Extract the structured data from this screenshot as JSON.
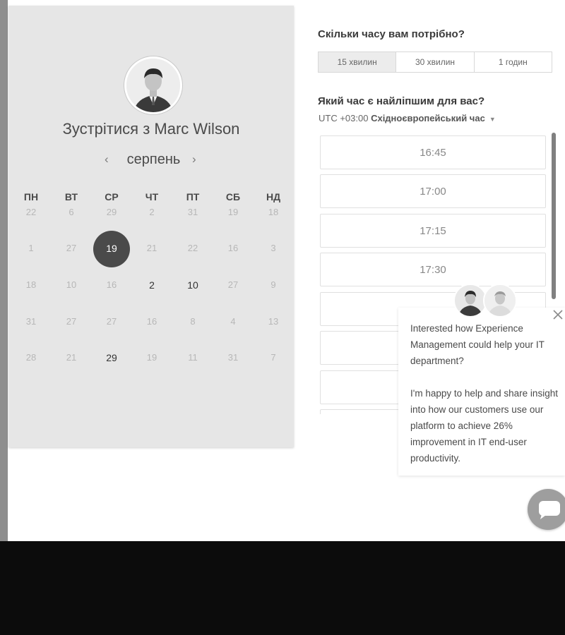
{
  "scheduler": {
    "title_prefix": "Зустрітися з",
    "host_name": "Marc Wilson",
    "month": "серпень",
    "weekdays": [
      "ПН",
      "ВТ",
      "СР",
      "ЧТ",
      "ПТ",
      "СБ",
      "НД"
    ],
    "calendar_rows": [
      [
        "22",
        "6",
        "29",
        "2",
        "31",
        "19",
        "18"
      ],
      [
        "1",
        "27",
        "19",
        "21",
        "22",
        "16",
        "3"
      ],
      [
        "18",
        "10",
        "16",
        "2",
        "10",
        "27",
        "9"
      ],
      [
        "31",
        "27",
        "27",
        "16",
        "8",
        "4",
        "13"
      ],
      [
        "28",
        "21",
        "29",
        "19",
        "11",
        "31",
        "7"
      ]
    ],
    "selected_day": "19",
    "duration_question": "Скільки часу вам потрібно?",
    "durations": [
      "15 хвилин",
      "30 хвилин",
      "1 годин"
    ],
    "time_question": "Який час є найліпшим для вас?",
    "timezone_offset": "UTC +03:00",
    "timezone_name": "Східноєвропейський час",
    "time_slots": [
      "16:45",
      "17:00",
      "17:15",
      "17:30"
    ]
  },
  "chat_popup": {
    "message_1": "Interested how Experience Management could help your IT department?",
    "message_2": "I'm happy to help and share insight into how our customers use our platform to achieve 26% improvement in IT end-user productivity."
  },
  "colors": {
    "panel_bg": "#e6e6e6",
    "selected_day_bg": "#4a4a4a",
    "chat_button": "#9e9e9e"
  },
  "icons": [
    "chevron-left-icon",
    "chevron-right-icon",
    "caret-down-icon",
    "close-icon",
    "chat-bubble-icon"
  ]
}
